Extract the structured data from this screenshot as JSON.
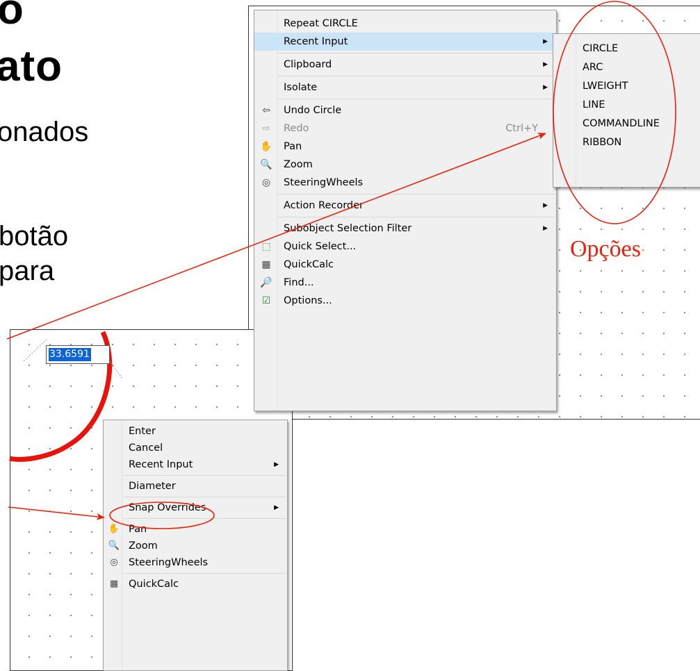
{
  "slide": {
    "title_line1": "o",
    "title_line2": "ato",
    "body_lines": [
      "onados",
      "botão",
      "para"
    ]
  },
  "top_menu": {
    "items": [
      {
        "label": "Repeat CIRCLE",
        "icon": "",
        "submenu": false
      },
      {
        "label": "Recent Input",
        "icon": "",
        "submenu": true,
        "highlighted": true
      },
      {
        "separator": true
      },
      {
        "label": "Clipboard",
        "icon": "",
        "submenu": true
      },
      {
        "separator": true
      },
      {
        "label": "Isolate",
        "icon": "",
        "submenu": true
      },
      {
        "separator": true
      },
      {
        "label": "Undo Circle",
        "icon": "undo-icon",
        "glyph": "⇦",
        "submenu": false
      },
      {
        "label": "Redo",
        "icon": "redo-icon",
        "glyph": "⇨",
        "shortcut": "Ctrl+Y",
        "disabled": true
      },
      {
        "label": "Pan",
        "icon": "pan-hand-icon",
        "glyph": "✋"
      },
      {
        "label": "Zoom",
        "icon": "zoom-icon",
        "glyph": "🔍"
      },
      {
        "label": "SteeringWheels",
        "icon": "steering-wheel-icon",
        "glyph": "◎"
      },
      {
        "separator": true
      },
      {
        "label": "Action Recorder",
        "icon": "",
        "submenu": true
      },
      {
        "separator": true
      },
      {
        "label": "Subobject Selection Filter",
        "icon": "",
        "submenu": true
      },
      {
        "label": "Quick Select...",
        "icon": "quick-select-icon",
        "glyph": "⬚"
      },
      {
        "label": "QuickCalc",
        "icon": "calculator-icon",
        "glyph": "▦"
      },
      {
        "label": "Find...",
        "icon": "find-icon",
        "glyph": "🔎"
      },
      {
        "label": "Options...",
        "icon": "options-check-icon",
        "glyph": "☑"
      }
    ]
  },
  "recent_input_submenu": [
    "CIRCLE",
    "ARC",
    "LWEIGHT",
    "LINE",
    "COMMANDLINE",
    "RIBBON"
  ],
  "annotation": {
    "label": "Opções",
    "color": "#e8220c"
  },
  "dimension_input": {
    "value": "33.6591"
  },
  "bottom_menu": {
    "items": [
      {
        "label": "Enter"
      },
      {
        "label": "Cancel"
      },
      {
        "label": "Recent Input",
        "submenu": true
      },
      {
        "separator": true
      },
      {
        "label": "Diameter",
        "circled": true
      },
      {
        "separator": true
      },
      {
        "label": "Snap Overrides",
        "submenu": true
      },
      {
        "separator": true
      },
      {
        "label": "Pan",
        "icon": "pan-hand-icon",
        "glyph": "✋"
      },
      {
        "label": "Zoom",
        "icon": "zoom-icon",
        "glyph": "🔍"
      },
      {
        "label": "SteeringWheels",
        "icon": "steering-wheel-icon",
        "glyph": "◎"
      },
      {
        "separator": true
      },
      {
        "label": "QuickCalc",
        "icon": "calculator-icon",
        "glyph": "▦"
      }
    ]
  },
  "colors": {
    "annotation_red": "#e8220c",
    "selection_blue": "#0a64d6",
    "highlight": "#cce4f7"
  }
}
